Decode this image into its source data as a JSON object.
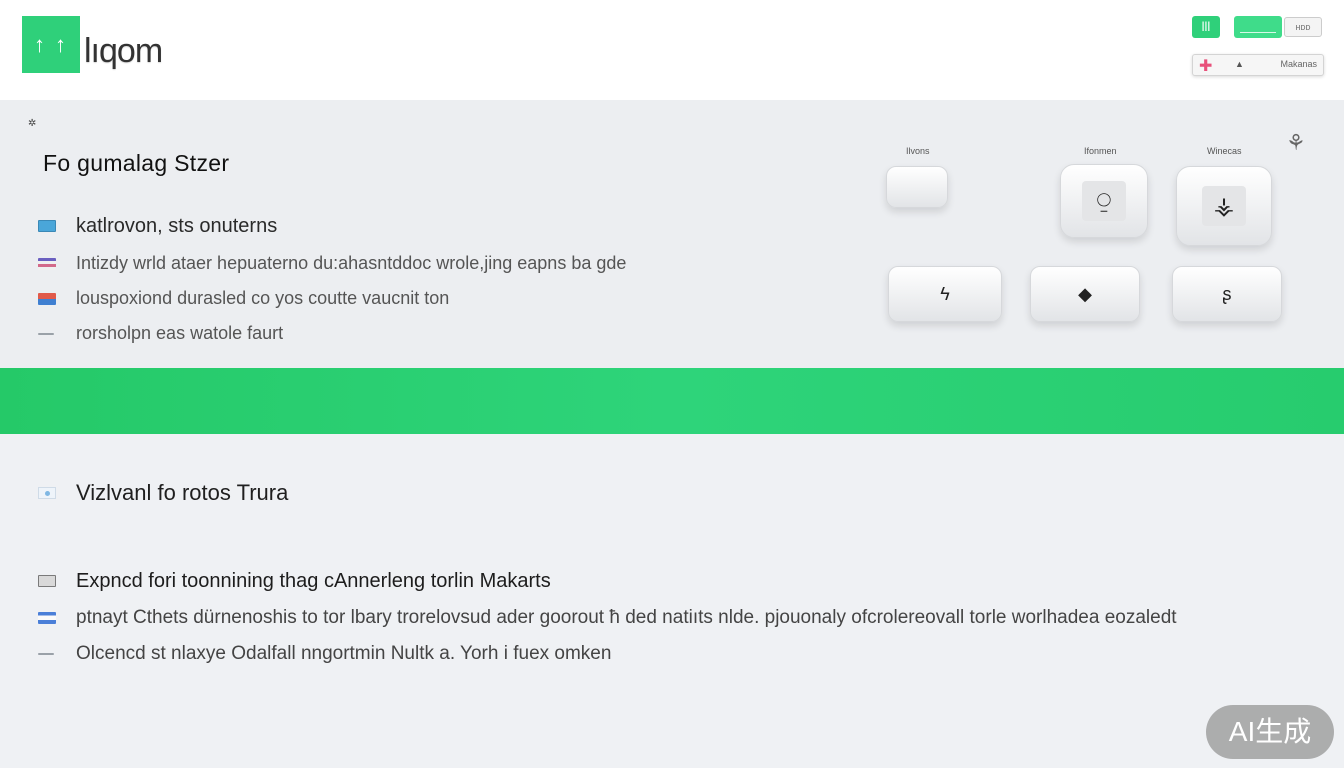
{
  "header": {
    "logo_mark": "↑ ↑",
    "logo_text": "lıqom",
    "btn_icon": "lll",
    "btn_small": "ʜᴅᴅ",
    "bar_mid": "▲",
    "bar_end": "Makanas"
  },
  "feature": {
    "small_mark": "✲",
    "title": "Fo gumalag Stzer",
    "items": [
      "katlrovon, sts onuterns",
      "Intizdy wrld ataer hepuaterno du:ahasntddoc wrole,jing eapns ba gde",
      "louspoxiond durasled co yos coutte vaucnit ton",
      "rorsholpn eas watole faurt"
    ],
    "tile_labels": [
      "Ilvons",
      "Ifonmen",
      "Winecas"
    ],
    "tile_glyphs": [
      "⍜",
      "⚶",
      "ϟ",
      "◆",
      "⇅",
      "ʂ"
    ],
    "corner_icon": "⚘"
  },
  "lower": {
    "subhead": "Vizlvanl fo rotos Trura",
    "items": [
      "Expncd fori toonnining thag cAnnerleng   torlin Makarts",
      "ptnayt Cthets dürnenoshis  to  tor lbary trorelovsud ader goorout  ħ ded natiıts nlde. pjouonaly ofcrolereovall torle worlhadea eozaledt",
      "Olcencd  st nlaxye Odalfall nngortmin Nultk a. Yorh  i fuex omken"
    ]
  },
  "watermark": "AI生成",
  "colors": {
    "accent_green": "#2fd07a",
    "band_green": "#2ed47a",
    "header_bg": "#ffffff",
    "page_bg": "#eff1f4"
  }
}
